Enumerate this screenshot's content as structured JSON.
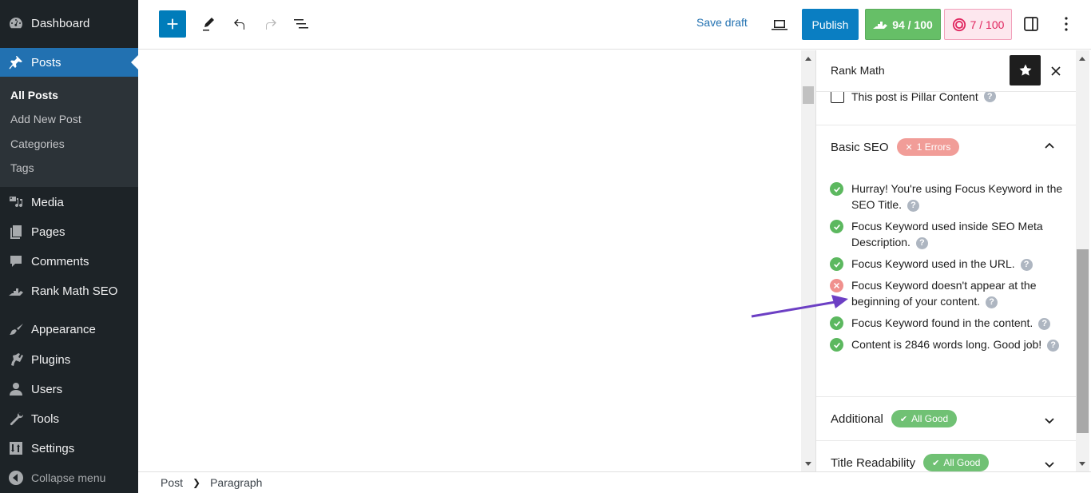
{
  "admin_menu": {
    "items": [
      {
        "label": "Dashboard",
        "icon": "dashboard-icon"
      },
      {
        "label": "Posts",
        "icon": "pin-icon",
        "active": true
      },
      {
        "label": "Media",
        "icon": "media-icon"
      },
      {
        "label": "Pages",
        "icon": "pages-icon"
      },
      {
        "label": "Comments",
        "icon": "comment-icon"
      },
      {
        "label": "Rank Math SEO",
        "icon": "rank-math-icon"
      },
      {
        "label": "Appearance",
        "icon": "paintbrush-icon"
      },
      {
        "label": "Plugins",
        "icon": "plug-icon"
      },
      {
        "label": "Users",
        "icon": "user-icon"
      },
      {
        "label": "Tools",
        "icon": "wrench-icon"
      },
      {
        "label": "Settings",
        "icon": "settings-sliders-icon"
      }
    ],
    "submenu": [
      {
        "label": "All Posts",
        "current": true
      },
      {
        "label": "Add New Post"
      },
      {
        "label": "Categories"
      },
      {
        "label": "Tags"
      }
    ],
    "collapse_label": "Collapse menu"
  },
  "toolbar": {
    "save_draft": "Save draft",
    "publish": "Publish",
    "seo_score": "94 / 100",
    "content_ai_score": "7 / 100"
  },
  "rank_math": {
    "title": "Rank Math",
    "pillar_label": "This post is Pillar Content",
    "pillar_checked": false,
    "help_glyph": "?",
    "basic_seo": {
      "title": "Basic SEO",
      "badge": "1 Errors",
      "expanded": true,
      "checks": [
        {
          "status": "ok",
          "text": "Hurray! You're using Focus Keyword in the SEO Title."
        },
        {
          "status": "ok",
          "text": "Focus Keyword used inside SEO Meta Description."
        },
        {
          "status": "ok",
          "text": "Focus Keyword used in the URL."
        },
        {
          "status": "fail",
          "text": "Focus Keyword doesn't appear at the beginning of your content."
        },
        {
          "status": "ok",
          "text": "Focus Keyword found in the content."
        },
        {
          "status": "ok",
          "text": "Content is 2846 words long. Good job!"
        }
      ]
    },
    "additional": {
      "title": "Additional",
      "badge": "All Good"
    },
    "title_readability": {
      "title": "Title Readability",
      "badge": "All Good"
    }
  },
  "footer": {
    "breadcrumb": [
      "Post",
      "Paragraph"
    ]
  },
  "colors": {
    "wp_blue": "#2271b1",
    "publish_blue": "#0a7ec2",
    "seo_green": "#66bf67",
    "content_ai_pink": "#e0245e",
    "error_badge": "#f19d98",
    "good_badge": "#70c174",
    "annotation_arrow": "#6c3fc4"
  }
}
